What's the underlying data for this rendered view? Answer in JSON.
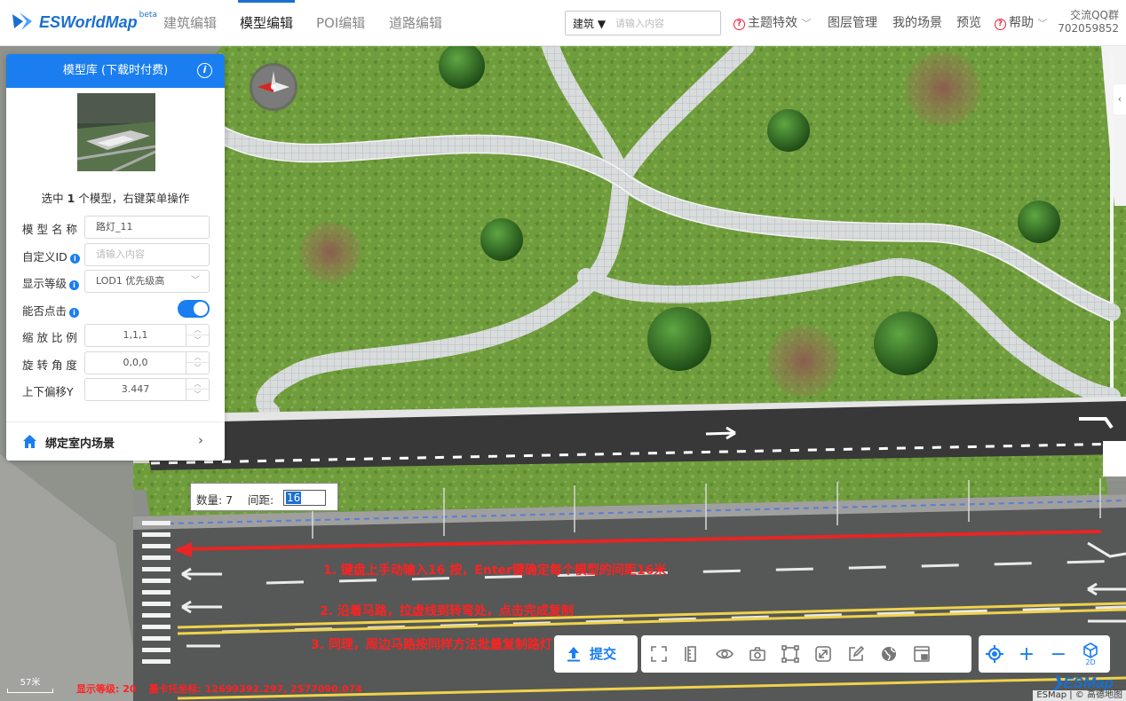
{
  "header": {
    "brand": "ESWorldMap",
    "beta": "beta",
    "tabs": [
      {
        "label": "建筑编辑"
      },
      {
        "label": "模型编辑"
      },
      {
        "label": "POI编辑"
      },
      {
        "label": "道路编辑"
      }
    ],
    "active_tab": "模型编辑",
    "search": {
      "type_label": "建筑",
      "placeholder": "请输入内容"
    },
    "theme_effect": "主题特效",
    "layer_manage": "图层管理",
    "my_scene": "我的场景",
    "preview": "预览",
    "help": "帮助",
    "qq_label": "交流QQ群",
    "qq_number": "702059852"
  },
  "panel": {
    "title": "模型库 (下载时付费)",
    "selection_prefix": "选中 ",
    "selection_count": "1",
    "selection_suffix": " 个模型，右键菜单操作",
    "fields": {
      "name_label": "模 型 名 称",
      "name_value": "路灯_11",
      "custom_id_label": "自定义ID",
      "custom_id_placeholder": "请输入内容",
      "display_level_label": "显示等级",
      "display_level_value": "LOD1 优先级高",
      "clickable_label": "能否点击",
      "clickable_on": true,
      "scale_label": "缩 放 比 例",
      "scale_value": "1,1,1",
      "rotation_label": "旋 转 角 度",
      "rotation_value": "0,0,0",
      "offset_label": "上下偏移Y",
      "offset_value": "3.447"
    },
    "bind_indoor": "绑定室内场景"
  },
  "count_box": {
    "count_label": "数量: 7",
    "spacing_label": "间距:",
    "spacing_value": "16"
  },
  "annotations": [
    "1. 键盘上手动输入16 按，Enter键确定每个模型的间距16米",
    "2. 沿着马路，拉虚线到转弯处，点击完成复制",
    "3. 同理，周边马路按同样方法批量复制路灯"
  ],
  "toolbar": {
    "submit": "提交",
    "tools": [
      "fullscreen-icon",
      "ruler-icon",
      "eye-icon",
      "camera-icon",
      "frame-icon",
      "resize-icon",
      "edit-icon",
      "globe-icon",
      "screen-icon"
    ],
    "zoom": {
      "mode_2d": "2D"
    }
  },
  "status": {
    "scale": "57米",
    "display_level": "显示等级: 20",
    "mercator": "墨卡托坐标: 12699392.297, 2577090.074",
    "logo": "ESMap",
    "copyright": "ESMap | © 高德地图"
  },
  "colors": {
    "accent": "#1a7ef0",
    "annotation": "#ff2222",
    "grass": "#6d9a3a",
    "road": "#3a3a3a"
  }
}
